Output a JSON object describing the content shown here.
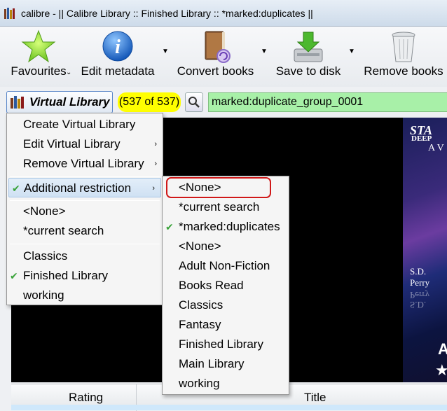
{
  "window": {
    "title": "calibre - || Calibre Library :: Finished Library :: *marked:duplicates ||"
  },
  "toolbar": {
    "favourites": "Favourites",
    "edit_metadata": "Edit metadata",
    "convert_books": "Convert books",
    "save_to_disk": "Save to disk",
    "remove_books": "Remove books",
    "dropdown_arrow": "⌄"
  },
  "searchbar": {
    "virtual_library_label": "Virtual Library",
    "count": "(537 of 537)",
    "query": "marked:duplicate_group_0001"
  },
  "vl_menu": {
    "items": [
      {
        "label": "Create Virtual Library"
      },
      {
        "label": "Edit Virtual Library"
      },
      {
        "label": "Remove Virtual Library"
      },
      {
        "label": "Additional restriction"
      },
      {
        "label": "<None>"
      },
      {
        "label": "*current search"
      },
      {
        "label": "Classics"
      },
      {
        "label": "Finished Library"
      },
      {
        "label": "working"
      }
    ],
    "submenu_arrow": "›",
    "check": "✔"
  },
  "restriction_menu": {
    "items": [
      {
        "label": "<None>"
      },
      {
        "label": "*current search"
      },
      {
        "label": "*marked:duplicates"
      },
      {
        "label": "<None>"
      },
      {
        "label": "Adult Non-Fiction"
      },
      {
        "label": "Books Read"
      },
      {
        "label": "Classics"
      },
      {
        "label": "Fantasy"
      },
      {
        "label": "Finished Library"
      },
      {
        "label": "Main Library"
      },
      {
        "label": "working"
      }
    ]
  },
  "cover": {
    "line1": "STA",
    "line2": "DEEP",
    "line3": "A V",
    "author1": "S.D.",
    "author2": "Perry",
    "mirror1": "Perry",
    "mirror2": "S.D.",
    "big_letter": "A",
    "star": "★"
  },
  "book_list": {
    "columns": [
      "Rating",
      "Title"
    ]
  },
  "colors": {
    "count_badge": "#ffff00",
    "search_field": "#a8f0a8",
    "highlight_ring": "#d01818",
    "check_mark": "#3aa33a"
  }
}
